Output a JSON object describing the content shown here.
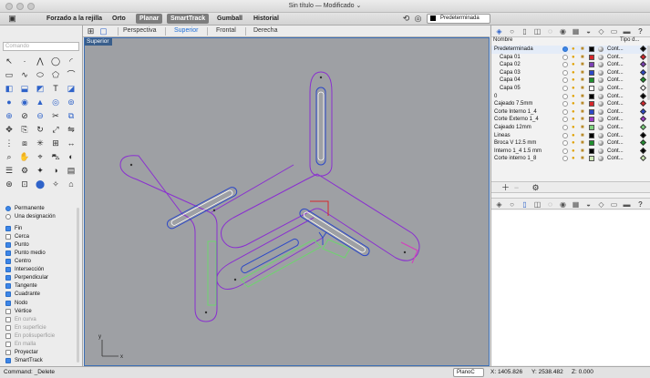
{
  "window": {
    "title": "Sin título — Modificado ⌄"
  },
  "toolbar": {
    "grid_snap": "Forzado a la rejilla",
    "ortho": "Orto",
    "planar": "Planar",
    "smarttrack": "SmartTrack",
    "gumball": "Gumball",
    "history": "Historial",
    "current_layer": "Predeterminada"
  },
  "left": {
    "command_placeholder": "Comando",
    "osnap_mode": [
      {
        "label": "Permanente",
        "selected": true
      },
      {
        "label": "Una designación",
        "selected": false
      }
    ],
    "osnaps": [
      {
        "label": "Fin",
        "checked": true,
        "enabled": true
      },
      {
        "label": "Cerca",
        "checked": false,
        "enabled": true
      },
      {
        "label": "Punto",
        "checked": true,
        "enabled": true
      },
      {
        "label": "Punto medio",
        "checked": true,
        "enabled": true
      },
      {
        "label": "Centro",
        "checked": true,
        "enabled": true
      },
      {
        "label": "Intersección",
        "checked": true,
        "enabled": true
      },
      {
        "label": "Perpendicular",
        "checked": true,
        "enabled": true
      },
      {
        "label": "Tangente",
        "checked": true,
        "enabled": true
      },
      {
        "label": "Cuadrante",
        "checked": true,
        "enabled": true
      },
      {
        "label": "Nodo",
        "checked": true,
        "enabled": true
      },
      {
        "label": "Vértice",
        "checked": false,
        "enabled": true
      },
      {
        "label": "En curva",
        "checked": false,
        "enabled": false
      },
      {
        "label": "En superficie",
        "checked": false,
        "enabled": false
      },
      {
        "label": "En polisuperficie",
        "checked": false,
        "enabled": false
      },
      {
        "label": "En malla",
        "checked": false,
        "enabled": false
      },
      {
        "label": "Proyectar",
        "checked": false,
        "enabled": true
      },
      {
        "label": "SmartTrack",
        "checked": true,
        "enabled": true
      }
    ]
  },
  "viewtabs": [
    "Perspectiva",
    "Superior",
    "Frontal",
    "Derecha"
  ],
  "active_view": "Superior",
  "viewport": {
    "label": "Superior",
    "axis_x": "x",
    "axis_y": "y"
  },
  "layers": {
    "col_name": "Nombre",
    "col_type": "Tipo d...",
    "rows": [
      {
        "name": "Predeterminada",
        "indent": 0,
        "current": true,
        "color": "#000000",
        "linetype": "Cont...",
        "print": "#000000"
      },
      {
        "name": "Capa 01",
        "indent": 1,
        "current": false,
        "color": "#d6262b",
        "linetype": "Cont...",
        "print": "#d6262b"
      },
      {
        "name": "Capa 02",
        "indent": 1,
        "current": false,
        "color": "#7c3fb5",
        "linetype": "Cont...",
        "print": "#7c3fb5"
      },
      {
        "name": "Capa 03",
        "indent": 1,
        "current": false,
        "color": "#2c48c7",
        "linetype": "Cont...",
        "print": "#2c48c7"
      },
      {
        "name": "Capa 04",
        "indent": 1,
        "current": false,
        "color": "#1f8f2e",
        "linetype": "Cont...",
        "print": "#1f8f2e"
      },
      {
        "name": "Capa 05",
        "indent": 1,
        "current": false,
        "color": "#ffffff",
        "linetype": "Cont...",
        "print": "#ffffff"
      },
      {
        "name": "0",
        "indent": 0,
        "current": false,
        "color": "#000000",
        "linetype": "Cont...",
        "print": "#000000"
      },
      {
        "name": "Cajeado 7.5mm",
        "indent": 0,
        "current": false,
        "color": "#d6262b",
        "linetype": "Cont...",
        "print": "#d6262b"
      },
      {
        "name": "Corte Interno 1_4",
        "indent": 0,
        "current": false,
        "color": "#2c48c7",
        "linetype": "Cont...",
        "print": "#2c48c7"
      },
      {
        "name": "Corte Externo 1_4",
        "indent": 0,
        "current": false,
        "color": "#a03bc6",
        "linetype": "Cont...",
        "print": "#a03bc6"
      },
      {
        "name": "Cajeado 12mm",
        "indent": 0,
        "current": false,
        "color": "#7fd37f",
        "linetype": "Cont...",
        "print": "#7fd37f"
      },
      {
        "name": "Lineas",
        "indent": 0,
        "current": false,
        "color": "#000000",
        "linetype": "Cont...",
        "print": "#000000"
      },
      {
        "name": "Broca V 12.5 mm",
        "indent": 0,
        "current": false,
        "color": "#1f8f2e",
        "linetype": "Cont...",
        "print": "#1f8f2e"
      },
      {
        "name": "Interno 1_4 1.5 mm",
        "indent": 0,
        "current": false,
        "color": "#000000",
        "linetype": "Cont...",
        "print": "#000000"
      },
      {
        "name": "Corte interno 1_8",
        "indent": 0,
        "current": false,
        "color": "#cde8b5",
        "linetype": "Cont...",
        "print": "#cde8b5"
      }
    ]
  },
  "status": {
    "command": "Command: _Delete",
    "plane": "PlanoC",
    "x": "X: 1405.826",
    "y": "Y: 2538.482",
    "z": "Z: 0.000"
  }
}
